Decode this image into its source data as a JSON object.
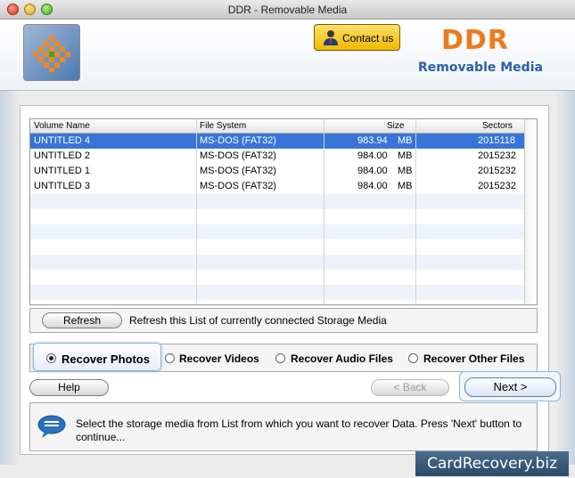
{
  "window": {
    "title": "DDR - Removable Media"
  },
  "header": {
    "contact_label": "Contact us",
    "brand_title": "DDR",
    "brand_subtitle": "Removable Media"
  },
  "table": {
    "columns": [
      "Volume Name",
      "File System",
      "Size",
      "Sectors"
    ],
    "rows": [
      {
        "name": "UNTITLED 4",
        "fs": "MS-DOS (FAT32)",
        "size": "983.94",
        "unit": "MB",
        "sectors": "2015118",
        "selected": true
      },
      {
        "name": "UNTITLED 2",
        "fs": "MS-DOS (FAT32)",
        "size": "984.00",
        "unit": "MB",
        "sectors": "2015232"
      },
      {
        "name": "UNTITLED 1",
        "fs": "MS-DOS (FAT32)",
        "size": "984.00",
        "unit": "MB",
        "sectors": "2015232"
      },
      {
        "name": "UNTITLED 3",
        "fs": "MS-DOS (FAT32)",
        "size": "984.00",
        "unit": "MB",
        "sectors": "2015232"
      }
    ]
  },
  "refresh": {
    "button_label": "Refresh",
    "description": "Refresh this List of currently connected Storage Media"
  },
  "options": {
    "items": [
      "Recover Photos",
      "Recover Videos",
      "Recover Audio Files",
      "Recover Other Files"
    ],
    "selected": "Recover Photos"
  },
  "nav": {
    "help_label": "Help",
    "back_label": "< Back",
    "next_label": "Next >"
  },
  "info": {
    "text": "Select the storage media from List from which you want to recover Data. Press 'Next' button to continue..."
  },
  "footer": {
    "brand": "CardRecovery.biz"
  },
  "colors": {
    "selection": "#3875d7",
    "brand_orange": "#ee7a1e",
    "brand_blue": "#2a5fa8"
  }
}
